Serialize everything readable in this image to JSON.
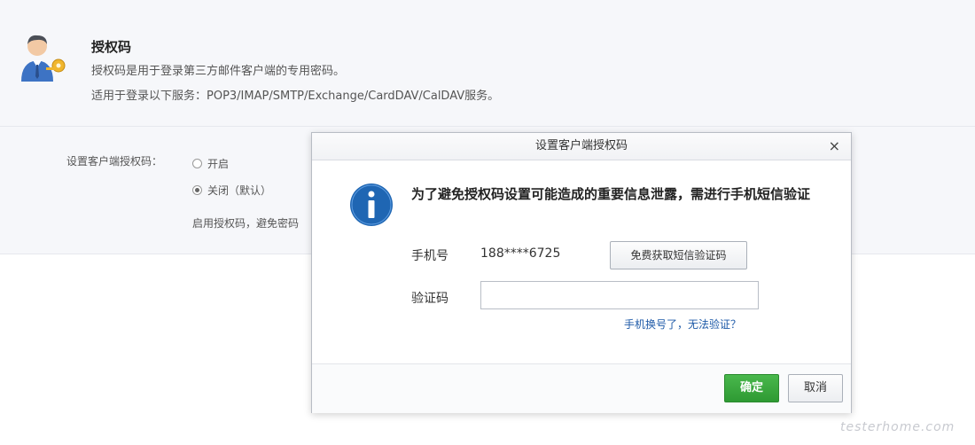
{
  "header": {
    "title": "授权码",
    "desc1": "授权码是用于登录第三方邮件客户端的专用密码。",
    "desc2": "适用于登录以下服务：POP3/IMAP/SMTP/Exchange/CardDAV/CalDAV服务。"
  },
  "settings": {
    "label": "设置客户端授权码：",
    "option_on": "开启",
    "option_off": "关闭（默认）",
    "selected": "关闭（默认）",
    "hint": "启用授权码，避免密码"
  },
  "dialog": {
    "title": "设置客户端授权码",
    "close": "×",
    "message": "为了避免授权码设置可能造成的重要信息泄露，需进行手机短信验证",
    "phone_label": "手机号",
    "phone_value": "188****6725",
    "sms_button": "免费获取短信验证码",
    "code_label": "验证码",
    "code_value": "",
    "code_placeholder": "",
    "help_link": "手机换号了，无法验证？",
    "ok_button": "确定",
    "cancel_button": "取消"
  },
  "icons": {
    "avatar": "user-key-icon",
    "info": "info-icon",
    "close": "close-icon"
  },
  "colors": {
    "ok_button": "#3aa83e",
    "link": "#1e5aa8",
    "info_icon": "#1f66b3"
  },
  "watermark": "testerhome.com"
}
